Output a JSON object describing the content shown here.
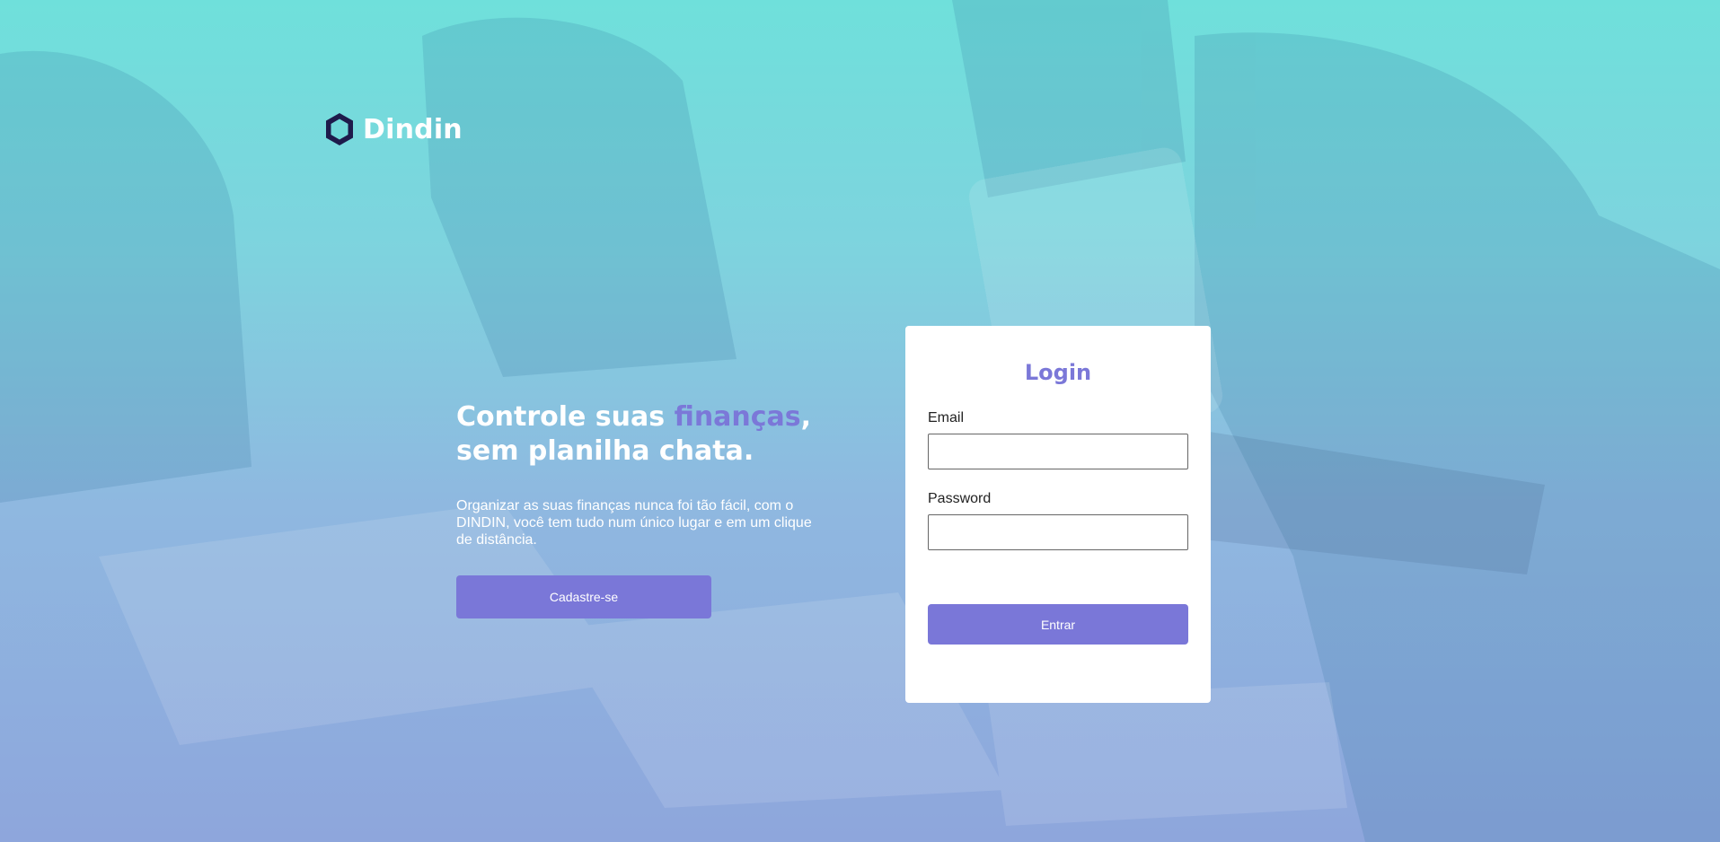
{
  "brand": {
    "name": "Dindin",
    "logo_icon": "hexagon-icon"
  },
  "hero": {
    "title_part1": "Controle suas ",
    "title_accent": "finanças",
    "title_part2": ",",
    "title_line2": "sem planilha chata.",
    "description": "Organizar as suas finanças nunca foi tão fácil, com o DINDIN, você tem tudo num único lugar e em um clique de distância.",
    "signup_label": "Cadastre-se"
  },
  "login": {
    "title": "Login",
    "email_label": "Email",
    "email_value": "",
    "password_label": "Password",
    "password_value": "",
    "submit_label": "Entrar"
  },
  "colors": {
    "accent": "#7b78d8",
    "bg_top": "#6fe0db",
    "bg_bottom": "#8ea6dc",
    "logo_dark": "#1e1b4b"
  }
}
